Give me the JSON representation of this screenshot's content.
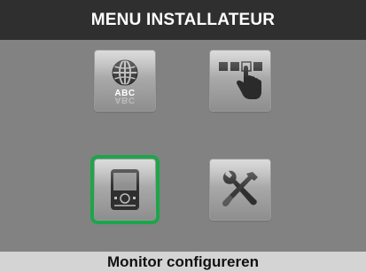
{
  "header": {
    "title": "MENU INSTALLATEUR"
  },
  "footer": {
    "status": "Monitor configureren"
  },
  "tiles": [
    {
      "icon": "language-globe-icon",
      "text": "ABC"
    },
    {
      "icon": "touch-hand-icon"
    },
    {
      "icon": "monitor-device-icon",
      "selected": true
    },
    {
      "icon": "wrench-screwdriver-icon"
    }
  ],
  "colors": {
    "screen_bg": "#828282",
    "title_bg": "#2f2f2f",
    "status_bg": "#d4d4d4",
    "selection": "#1ca64a"
  }
}
